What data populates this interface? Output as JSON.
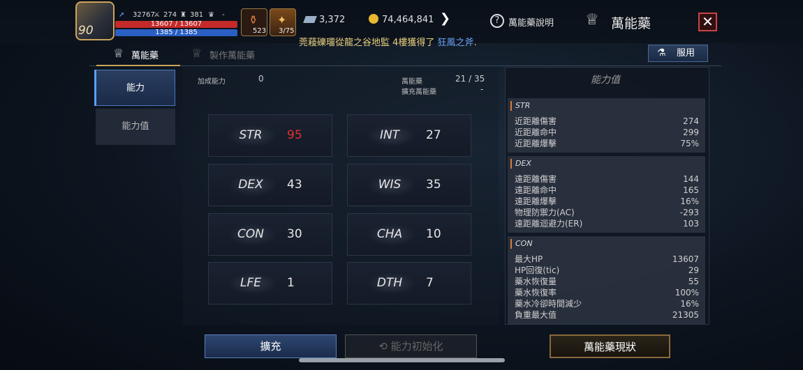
{
  "player": {
    "level": "90",
    "stat_a": "32767",
    "stat_b": "274",
    "stat_c": "381",
    "stat_d": "-",
    "hp": "13607 / 13607",
    "mp": "1385 / 1385",
    "potion_count": "523",
    "elixir_count": "3/75"
  },
  "currency": {
    "gems": "3,372",
    "gold": "74,464,841"
  },
  "header": {
    "help_label": "萬能藥說明",
    "title": "萬能藥",
    "notice_text": "莞薐礫璢從龍之谷地監 4樓獲得了",
    "notice_link": "狂風之斧",
    "notice_end": "."
  },
  "tabs": [
    {
      "label": "萬能藥"
    },
    {
      "label": "製作萬能藥"
    }
  ],
  "use_button": "服用",
  "side_tabs": [
    {
      "label": "能力"
    },
    {
      "label": "能力值"
    }
  ],
  "main": {
    "bonus_label": "加成能力",
    "bonus_value": "0",
    "elixir_label": "萬能藥",
    "elixir_value": "21 / 35",
    "expand_label": "擴充萬能藥",
    "expand_value": "-"
  },
  "stats": [
    {
      "name": "STR",
      "value": "95",
      "color": "#e03030"
    },
    {
      "name": "INT",
      "value": "27",
      "color": "#e6e6e6"
    },
    {
      "name": "DEX",
      "value": "43",
      "color": "#e6e6e6"
    },
    {
      "name": "WIS",
      "value": "35",
      "color": "#e6e6e6"
    },
    {
      "name": "CON",
      "value": "30",
      "color": "#e6e6e6"
    },
    {
      "name": "CHA",
      "value": "10",
      "color": "#e6e6e6"
    },
    {
      "name": "LFE",
      "value": "1",
      "color": "#e6e6e6"
    },
    {
      "name": "DTH",
      "value": "7",
      "color": "#e6e6e6"
    }
  ],
  "right_panel": {
    "title": "能力值",
    "sections": [
      {
        "header": "STR",
        "rows": [
          {
            "label": "近距離傷害",
            "value": "274"
          },
          {
            "label": "近距離命中",
            "value": "299"
          },
          {
            "label": "近距離爆擊",
            "value": "75%"
          }
        ]
      },
      {
        "header": "DEX",
        "rows": [
          {
            "label": "遠距離傷害",
            "value": "144"
          },
          {
            "label": "遠距離命中",
            "value": "165"
          },
          {
            "label": "遠距離爆擊",
            "value": "16%"
          },
          {
            "label": "物理防禦力(AC)",
            "value": "-293"
          },
          {
            "label": "遠距離迴避力(ER)",
            "value": "103"
          }
        ]
      },
      {
        "header": "CON",
        "rows": [
          {
            "label": "最大HP",
            "value": "13607"
          },
          {
            "label": "HP回復(tic)",
            "value": "29"
          },
          {
            "label": "藥水恢復量",
            "value": "55"
          },
          {
            "label": "藥水恢復率",
            "value": "100%"
          },
          {
            "label": "藥水冷卻時間減少",
            "value": "16%"
          },
          {
            "label": "負重最大值",
            "value": "21305"
          }
        ]
      }
    ]
  },
  "bottom": {
    "expand": "擴充",
    "reset": "能力初始化",
    "status": "萬能藥現狀"
  }
}
